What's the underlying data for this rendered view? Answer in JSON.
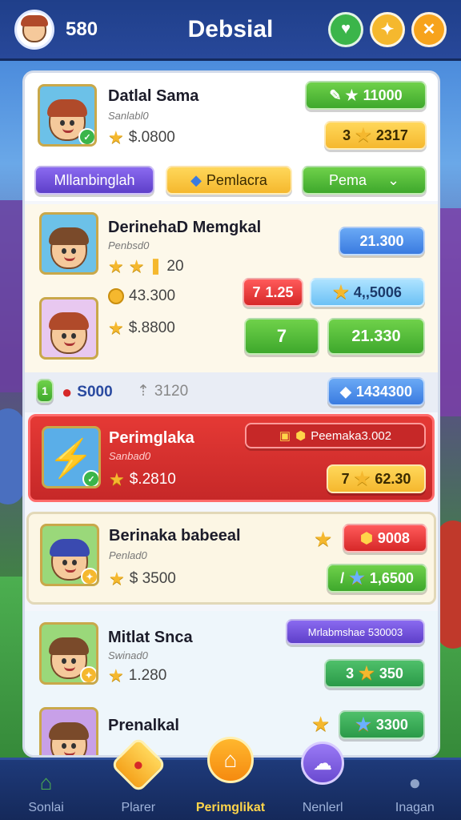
{
  "header": {
    "coins": "580",
    "title": "Debsial",
    "icons": [
      "heart-badge-icon",
      "puzzle-icon",
      "close-icon"
    ]
  },
  "tabs": {
    "tab1": "Mllanbinglah",
    "tab2": "Pemlacra",
    "tab3": "Pema"
  },
  "card1": {
    "name": "Datlal Sama",
    "sub": "Sanlabl0",
    "stat": "$.0800",
    "btn_top": "11000",
    "btn_bottom_prefix": "3",
    "btn_bottom": "2317"
  },
  "card2": {
    "name": "DerinehaD Memgkal",
    "sub": "Penbsd0",
    "stars_value": "20",
    "coin_stat": "43.300",
    "stat": "$.8800",
    "blue_btn": "21.300",
    "red_btn_prefix": "7",
    "red_btn": "1.25",
    "lblue_btn": "4,,5006",
    "green_small": "7",
    "green_big": "21.330"
  },
  "divider": {
    "index": "1",
    "primary": "S000",
    "secondary": "3120",
    "blue_btn": "1434300"
  },
  "card3": {
    "name": "Perimglaka",
    "sub": "Sanbad0",
    "stat": "$.2810",
    "top_btn": "Peemaka3.002",
    "bottom_prefix": "7",
    "bottom_btn": "62.30"
  },
  "card4": {
    "name": "Berinaka babeeal",
    "sub": "Penlad0",
    "stat": "$ 3500",
    "red_btn": "9008",
    "green_btn_prefix": "/",
    "green_btn": "1,6500"
  },
  "card5": {
    "name": "Mitlat Snca",
    "sub": "Swinad0",
    "stat": "1.280",
    "purple_btn": "Mrlabmshae 530003",
    "green_prefix": "3",
    "green_btn": "350"
  },
  "card6": {
    "name": "Prenalkal",
    "green_btn": "3300"
  },
  "nav": {
    "items": [
      {
        "label": "Sonlai",
        "icon": "home-icon"
      },
      {
        "label": "Plarer",
        "icon": "badge-icon"
      },
      {
        "label": "Perimglikat",
        "icon": "house-icon"
      },
      {
        "label": "Nenlerl",
        "icon": "cloud-icon"
      },
      {
        "label": "Inagan",
        "icon": "user-icon"
      }
    ],
    "active_index": 2
  },
  "colors": {
    "topbar": "#1f3f8a",
    "accent_green": "#3ea82c",
    "accent_yellow": "#f5b82e",
    "accent_red": "#d62828",
    "accent_blue": "#3a7be0"
  }
}
